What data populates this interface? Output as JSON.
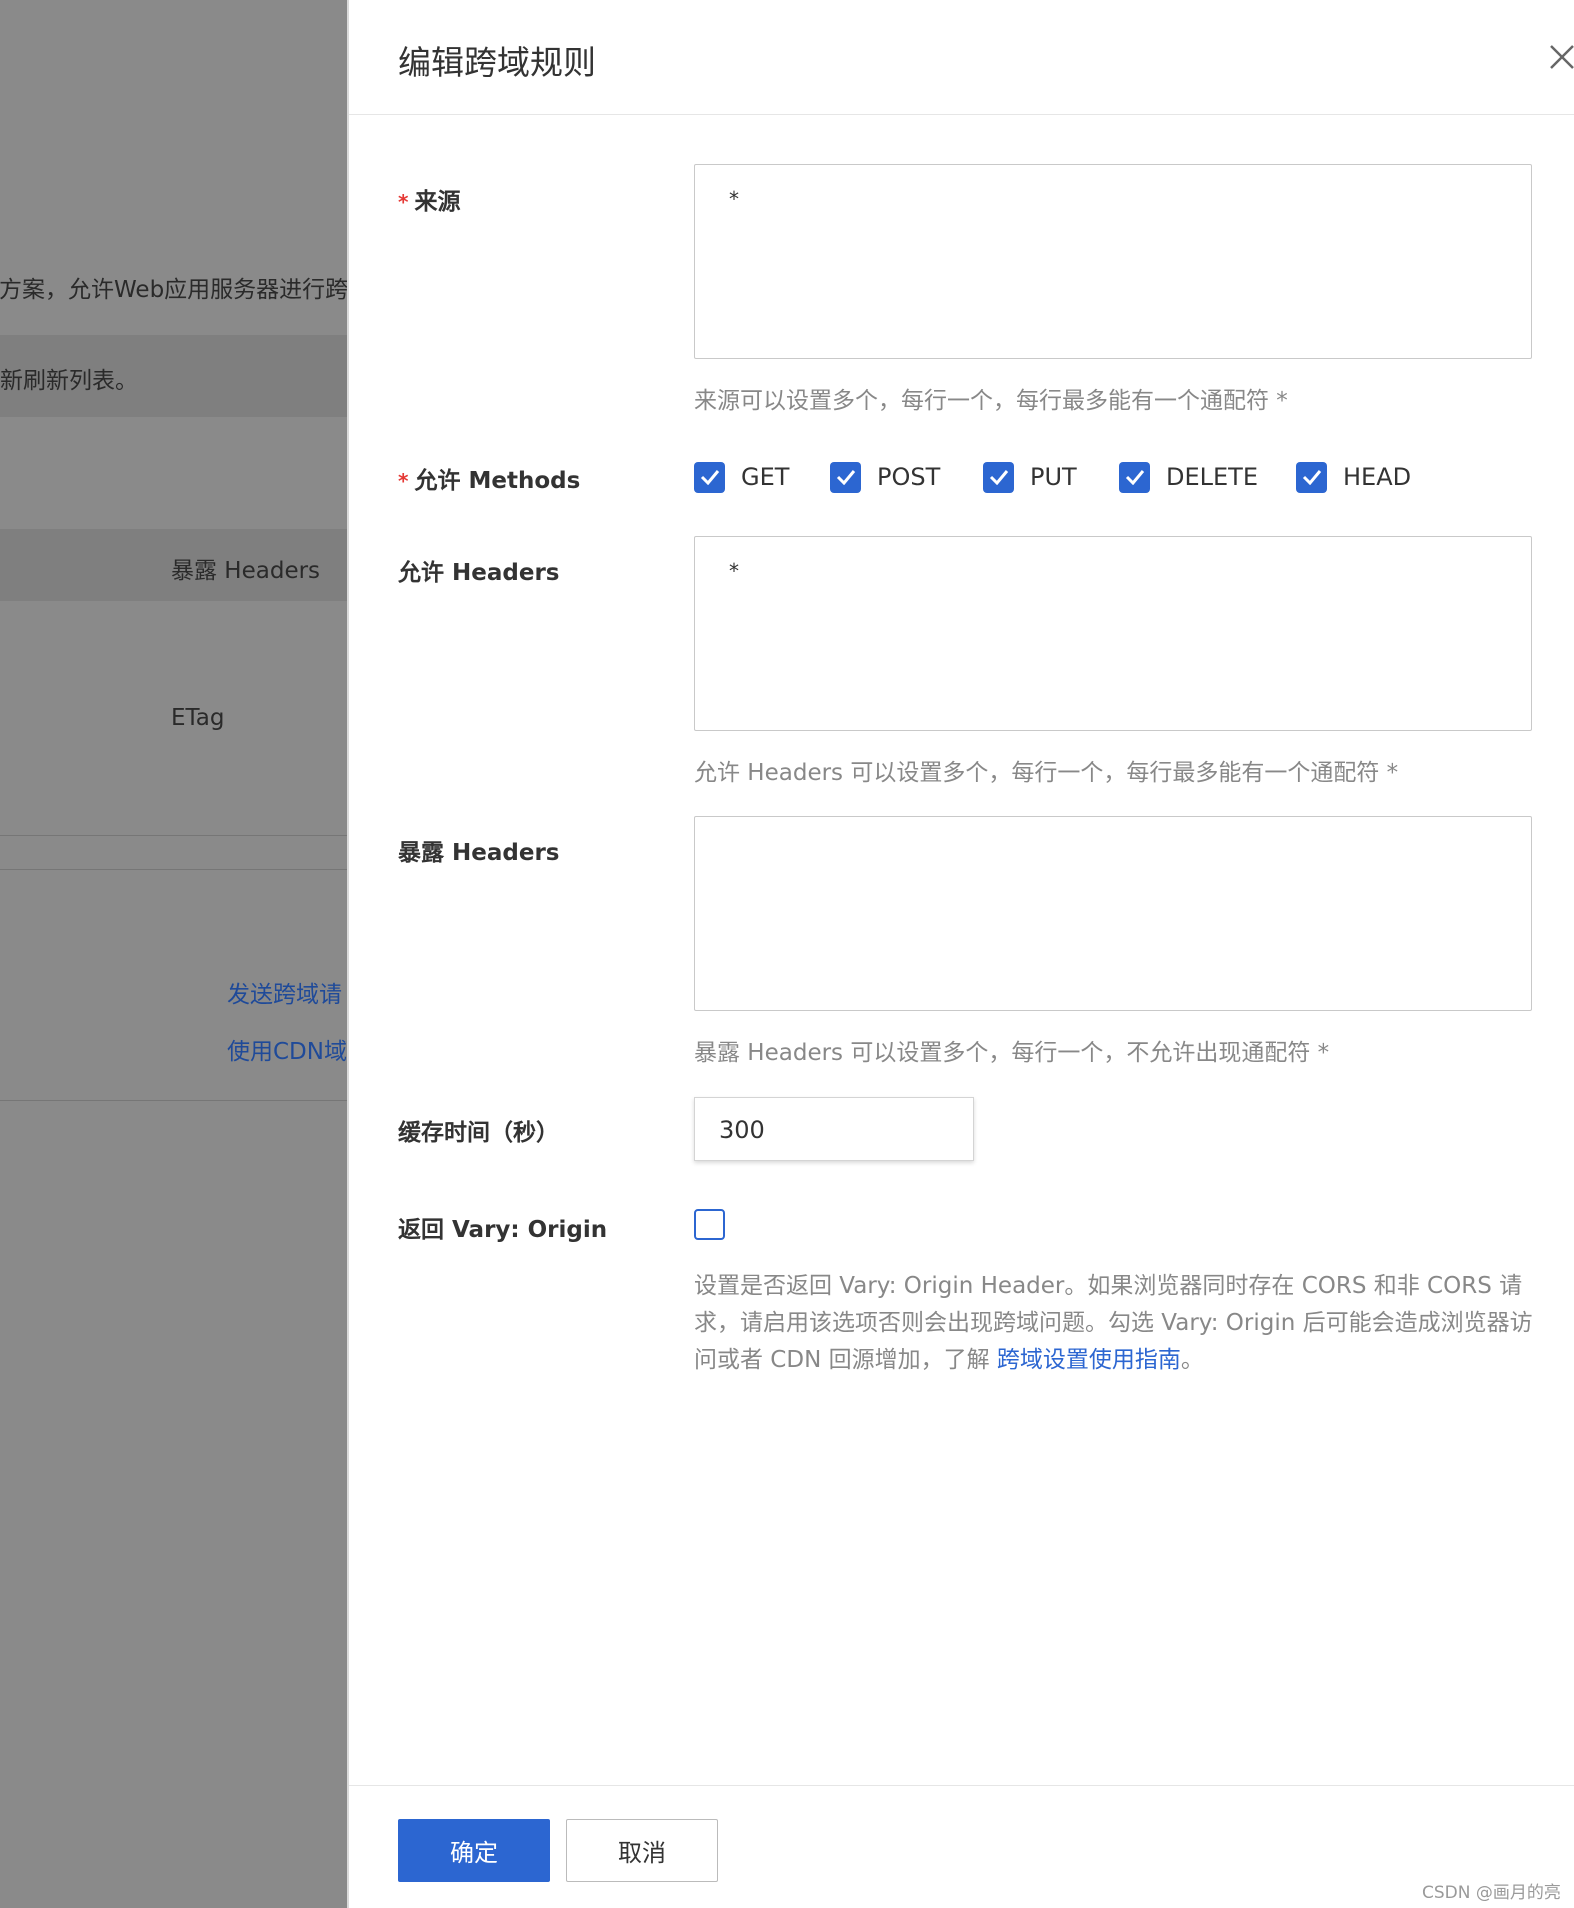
{
  "background": {
    "text_intro": "t方案，允许Web应用服务器进行跨",
    "text_refresh": "新刷新列表。",
    "col_expose_headers": "暴露 Headers",
    "cell_etag": "ETag",
    "link_send": "发送跨域请",
    "link_cdn": "使用CDN域"
  },
  "drawer": {
    "title": "编辑跨域规则",
    "fields": {
      "origin": {
        "label": "来源",
        "value": "*",
        "hint": "来源可以设置多个，每行一个，每行最多能有一个通配符 *"
      },
      "methods": {
        "label": "允许 Methods",
        "options": [
          "GET",
          "POST",
          "PUT",
          "DELETE",
          "HEAD"
        ]
      },
      "allow_headers": {
        "label": "允许 Headers",
        "value": "*",
        "hint": "允许 Headers 可以设置多个，每行一个，每行最多能有一个通配符 *"
      },
      "expose_headers": {
        "label": "暴露 Headers",
        "value": "",
        "hint": "暴露 Headers 可以设置多个，每行一个，不允许出现通配符 *"
      },
      "cache": {
        "label": "缓存时间（秒）",
        "value": "300"
      },
      "vary": {
        "label": "返回 Vary: Origin",
        "checked": false,
        "hint_before": "设置是否返回 Vary: Origin Header。如果浏览器同时存在 CORS 和非 CORS 请求，请启用该选项否则会出现跨域问题。勾选 Vary: Origin 后可能会造成浏览器访问或者 CDN 回源增加，了解 ",
        "hint_link": "跨域设置使用指南",
        "hint_after": "。"
      }
    },
    "footer": {
      "ok_label": "确定",
      "cancel_label": "取消"
    },
    "required_mark": "*"
  },
  "watermark": "CSDN @画月的亮",
  "colors": {
    "primary": "#2c66d1",
    "required": "#e53935",
    "hint": "#888888"
  }
}
